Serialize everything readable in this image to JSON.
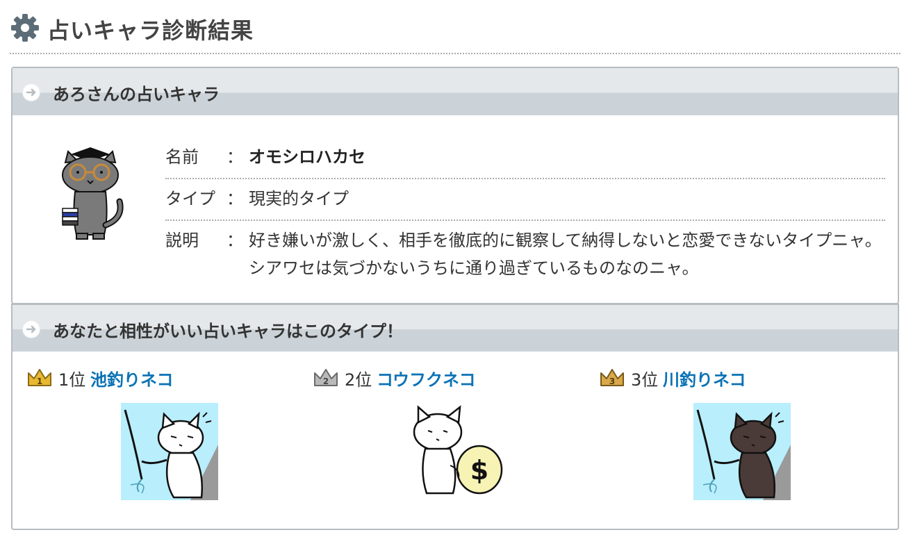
{
  "page": {
    "title": "占いキャラ診断結果",
    "icon": "gear-icon"
  },
  "result": {
    "heading": "あろさんの占いキャラ",
    "rows": {
      "name": {
        "label": "名前",
        "colon": "：",
        "value": "オモシロハカセ"
      },
      "type": {
        "label": "タイプ",
        "colon": "：",
        "value": "現実的タイプ"
      },
      "desc": {
        "label": "説明",
        "colon": "：",
        "value": "好き嫌いが激しく、相手を徹底的に観察して納得しないと恋愛できないタイプニャ。シアワセは気づかないうちに通り過ぎているものなのニャ。"
      }
    }
  },
  "compat": {
    "heading": "あなたと相性がいい占いキャラはこのタイプ！",
    "ranks": [
      {
        "pos": "1位",
        "name": "池釣りネコ",
        "crown_color": "#e8b830"
      },
      {
        "pos": "2位",
        "name": "コウフクネコ",
        "crown_color": "#b9b9b9"
      },
      {
        "pos": "3位",
        "name": "川釣りネコ",
        "crown_color": "#d9a84a"
      }
    ]
  },
  "colors": {
    "link": "#0b72b5",
    "header_band_light": "#e4e8eb",
    "header_band_dark": "#ccd3d8",
    "image_sky": "#b9eefc"
  }
}
